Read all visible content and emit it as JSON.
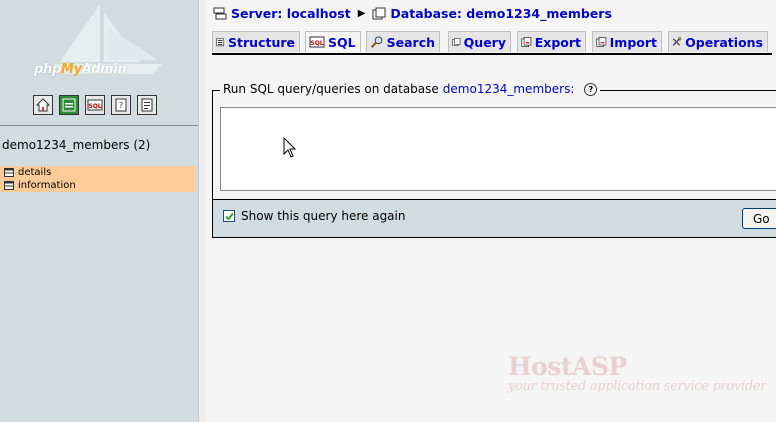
{
  "sidebar": {
    "logo": {
      "php": "php",
      "my": "My",
      "admin": "Admin"
    },
    "nav_icons": [
      {
        "name": "home-icon"
      },
      {
        "name": "query-window-icon"
      },
      {
        "name": "sql-icon",
        "text": "SQL"
      },
      {
        "name": "docs-icon"
      },
      {
        "name": "sql-docs-icon"
      }
    ],
    "db_title": "demo1234_members (2)",
    "tables": [
      {
        "label": "details"
      },
      {
        "label": "information"
      }
    ],
    "highlight_color": "#ffcc99"
  },
  "breadcrumb": {
    "server_label": "Server: localhost",
    "database_label": "Database: demo1234_members"
  },
  "tabs": [
    {
      "label": "Structure",
      "icon": "structure-icon"
    },
    {
      "label": "SQL",
      "icon": "sql-tab-icon",
      "active": true
    },
    {
      "label": "Search",
      "icon": "magnifier-icon"
    },
    {
      "label": "Query",
      "icon": "query-icon"
    },
    {
      "label": "Export",
      "icon": "export-icon"
    },
    {
      "label": "Import",
      "icon": "import-icon"
    },
    {
      "label": "Operations",
      "icon": "wrench-icon"
    }
  ],
  "sql_form": {
    "legend_prefix": "Run SQL query/queries on database",
    "legend_db": "demo1234_members:",
    "query_value": "",
    "show_again_label": "Show this query here again",
    "show_again_checked": true,
    "go_label": "Go"
  },
  "watermark": {
    "brand_a": "Host",
    "brand_b": "ASP",
    "tagline": "your trusted application service provider"
  },
  "colors": {
    "link": "#0000cc",
    "sidebar_bg": "#d0dce0",
    "page_bg": "#f5f5f5"
  }
}
